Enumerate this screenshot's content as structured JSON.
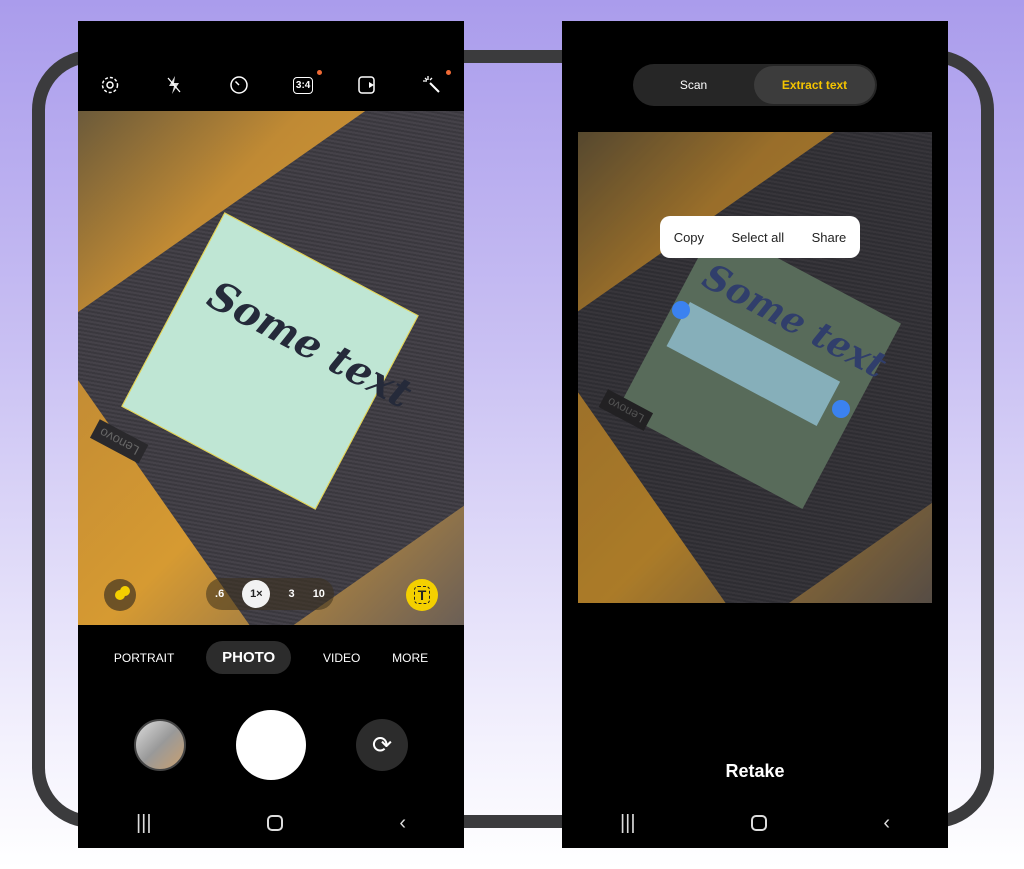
{
  "camera": {
    "toolbar": [
      {
        "icon": "gear-icon"
      },
      {
        "icon": "flash-off-icon"
      },
      {
        "icon": "timer-icon"
      },
      {
        "icon": "ratio-icon",
        "label": "3:4"
      },
      {
        "icon": "motion-photo-icon"
      },
      {
        "icon": "effects-wand-icon"
      }
    ],
    "photo_text": "Some text",
    "brand_text": "Lenovo",
    "zoom_levels": [
      ".6",
      "1×",
      "3",
      "10"
    ],
    "modes": [
      "PORTRAIT",
      "PHOTO",
      "VIDEO",
      "MORE"
    ],
    "active_mode": "PHOTO",
    "accent": "#f4d000"
  },
  "extract": {
    "tabs": [
      "Scan",
      "Extract text"
    ],
    "active_tab": "Extract text",
    "context_menu": [
      "Copy",
      "Select all",
      "Share"
    ],
    "photo_text": "Some text",
    "retake_label": "Retake",
    "accent": "#f4c400",
    "selection_color": "#3b82f0"
  }
}
